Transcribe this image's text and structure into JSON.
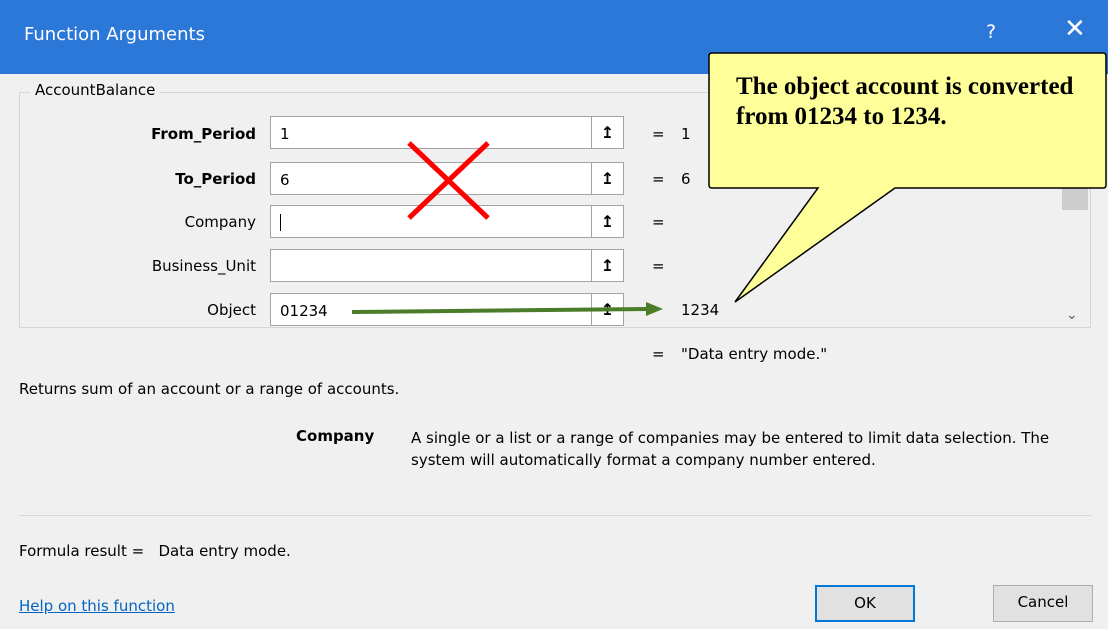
{
  "titlebar": {
    "title": "Function Arguments",
    "help": "?",
    "close": "✕"
  },
  "group": {
    "title": "AccountBalance"
  },
  "args": [
    {
      "label": "From_Period",
      "value": "1",
      "eq": "=",
      "result": "1"
    },
    {
      "label": "To_Period",
      "value": "6",
      "eq": "=",
      "result": "6"
    },
    {
      "label": "Company",
      "value": "",
      "eq": "=",
      "result": ""
    },
    {
      "label": "Business_Unit",
      "value": "",
      "eq": "=",
      "result": ""
    },
    {
      "label": "Object",
      "value": "01234",
      "eq": "",
      "result": "1234"
    }
  ],
  "ref_icon": "↥",
  "formula": {
    "eq": "=",
    "value": "\"Data entry mode.\""
  },
  "description": "Returns sum of an account or a range of accounts.",
  "arg_help": {
    "name": "Company",
    "text": "A single or a list or a range of companies may be entered to limit data selection. The system will automatically format a company number entered."
  },
  "result": {
    "label": "Formula result =   Data entry mode."
  },
  "help_link": "Help on this function",
  "buttons": {
    "ok": "OK",
    "cancel": "Cancel"
  },
  "callout": {
    "text": "The object account is converted from 01234 to 1234."
  },
  "colors": {
    "titlebar": "#2b78d8",
    "cross": "#ff0000",
    "arrow": "#4a7c2a",
    "callout_fill": "#ffff99"
  }
}
